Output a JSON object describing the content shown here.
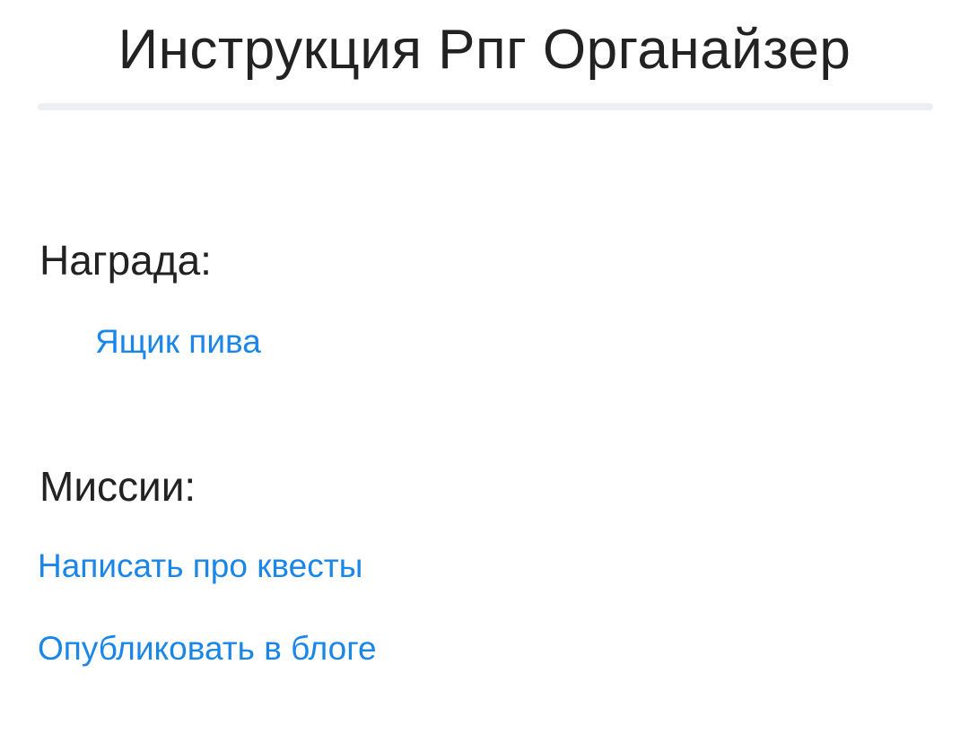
{
  "page": {
    "title": "Инструкция Рпг Органайзер"
  },
  "reward": {
    "heading": "Награда:",
    "item": "Ящик пива"
  },
  "missions": {
    "heading": "Миссии:",
    "items": [
      "Написать про квесты",
      "Опубликовать в блоге"
    ]
  },
  "colors": {
    "link": "#1a86e8",
    "text": "#222222",
    "divider": "#eceef1"
  }
}
